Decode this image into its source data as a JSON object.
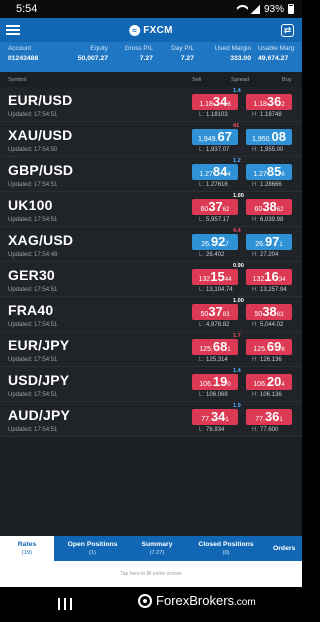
{
  "statusbar": {
    "time": "5:54",
    "battery": "93%"
  },
  "appbar": {
    "brand": "FXCM"
  },
  "account": {
    "columns": [
      {
        "label": "Account",
        "value": "01243488"
      },
      {
        "label": "Equity",
        "value": "50,007.27"
      },
      {
        "label": "Gross P/L",
        "value": "7.27"
      },
      {
        "label": "Day P/L",
        "value": "7.27"
      },
      {
        "label": "Used Margin",
        "value": "333.00"
      },
      {
        "label": "Usable Marg",
        "value": "49,674.27"
      }
    ]
  },
  "headers": {
    "symbol": "Symbol",
    "sell": "Sell",
    "spread": "Spread",
    "buy": "Buy"
  },
  "labels": {
    "low": "L:",
    "high": "H:"
  },
  "colors": {
    "sell_down": "#dc3a54",
    "price_up": "#2f92d6",
    "spread_red": "#ff4b5c",
    "spread_blue": "#4fb0ff",
    "spread_white": "#ffffff"
  },
  "rates": [
    {
      "symbol": "EUR/USD",
      "updated": "Updated: 17:54:51",
      "spread": "1.4",
      "spread_color": "blue",
      "sell": {
        "pre": "1.18",
        "big": "34",
        "pip": "8",
        "color": "red"
      },
      "buy": {
        "pre": "1.18",
        "big": "36",
        "pip": "2",
        "color": "red"
      },
      "low": "1.18103",
      "high": "1.18748"
    },
    {
      "symbol": "XAU/USD",
      "updated": "Updated: 17:54:50",
      "spread": "41",
      "spread_color": "red",
      "sell": {
        "pre": "1,949.",
        "big": "67",
        "pip": "",
        "color": "blue"
      },
      "buy": {
        "pre": "1,950.",
        "big": "08",
        "pip": "",
        "color": "blue"
      },
      "low": "1,937.07",
      "high": "1,955.00"
    },
    {
      "symbol": "GBP/USD",
      "updated": "Updated: 17:54:51",
      "spread": "1.2",
      "spread_color": "blue",
      "sell": {
        "pre": "1.27",
        "big": "84",
        "pip": "4",
        "color": "blue"
      },
      "buy": {
        "pre": "1.27",
        "big": "85",
        "pip": "6",
        "color": "blue"
      },
      "low": "1.27616",
      "high": "1.28666"
    },
    {
      "symbol": "UK100",
      "updated": "Updated: 17:54:51",
      "spread": "1.00",
      "spread_color": "white",
      "sell": {
        "pre": "60",
        "big": "37",
        "pip": "62",
        "color": "red"
      },
      "buy": {
        "pre": "60",
        "big": "38",
        "pip": "62",
        "color": "red"
      },
      "low": "5,957.17",
      "high": "6,039.98"
    },
    {
      "symbol": "XAG/USD",
      "updated": "Updated: 17:54:48",
      "spread": "4.4",
      "spread_color": "red",
      "sell": {
        "pre": "26.",
        "big": "92",
        "pip": "7",
        "color": "blue"
      },
      "buy": {
        "pre": "26.",
        "big": "97",
        "pip": "1",
        "color": "blue"
      },
      "low": "26.402",
      "high": "27.204"
    },
    {
      "symbol": "GER30",
      "updated": "Updated: 17:54:51",
      "spread": "0.90",
      "spread_color": "white",
      "sell": {
        "pre": "132",
        "big": "15",
        "pip": "44",
        "color": "red"
      },
      "buy": {
        "pre": "132",
        "big": "16",
        "pip": "34",
        "color": "red"
      },
      "low": "13,104.74",
      "high": "13,257.94"
    },
    {
      "symbol": "FRA40",
      "updated": "Updated: 17:54:51",
      "spread": "1.00",
      "spread_color": "white",
      "sell": {
        "pre": "50",
        "big": "37",
        "pip": "83",
        "color": "red"
      },
      "buy": {
        "pre": "50",
        "big": "38",
        "pip": "83",
        "color": "red"
      },
      "low": "4,978.82",
      "high": "5,044.02"
    },
    {
      "symbol": "EUR/JPY",
      "updated": "Updated: 17:54:51",
      "spread": "1.7",
      "spread_color": "red",
      "sell": {
        "pre": "125.",
        "big": "68",
        "pip": "1",
        "color": "red"
      },
      "buy": {
        "pre": "125.",
        "big": "69",
        "pip": "8",
        "color": "red"
      },
      "low": "125.314",
      "high": "126.136"
    },
    {
      "symbol": "USD/JPY",
      "updated": "Updated: 17:54:51",
      "spread": "1.4",
      "spread_color": "blue",
      "sell": {
        "pre": "106.",
        "big": "19",
        "pip": "0",
        "color": "red"
      },
      "buy": {
        "pre": "106.",
        "big": "20",
        "pip": "4",
        "color": "red"
      },
      "low": "106.068",
      "high": "106.136"
    },
    {
      "symbol": "AUD/JPY",
      "updated": "Updated: 17:54:51",
      "spread": "1.9",
      "spread_color": "blue",
      "sell": {
        "pre": "77.",
        "big": "34",
        "pip": "1",
        "color": "red"
      },
      "buy": {
        "pre": "77.",
        "big": "36",
        "pip": "1",
        "color": "red"
      },
      "low": "76.934",
      "high": "77.600"
    }
  ],
  "tabs": [
    {
      "label": "Rates",
      "count": "(19)",
      "active": true
    },
    {
      "label": "Open Positions",
      "count": "(1)",
      "active": false
    },
    {
      "label": "Summary",
      "count": "(7.27)",
      "active": false
    },
    {
      "label": "Closed Positions",
      "count": "(0)",
      "active": false
    },
    {
      "label": "Orders",
      "count": "",
      "active": false
    }
  ],
  "hint": "Tap here to fill entire screen",
  "watermark": {
    "name": "ForexBrokers",
    "suffix": ".com"
  }
}
